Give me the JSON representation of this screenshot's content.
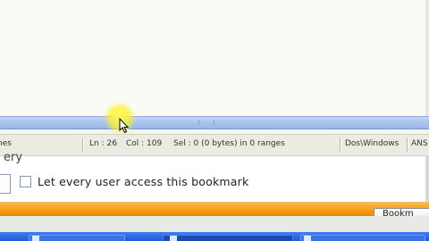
{
  "statusbar": {
    "partial_left": "nes",
    "line": "Ln : 26",
    "column": "Col : 109",
    "selection": "Sel : 0 (0 bytes) in 0 ranges",
    "line_endings": "Dos\\Windows",
    "encoding_partial": "ANS"
  },
  "form": {
    "partial_label": "ery",
    "checkbox_label": "Let every user access this bookmark",
    "checkbox_checked": false
  },
  "orange_bar": {
    "button_partial_label": "Bookm"
  },
  "colors": {
    "splitter": "#a9c3ee",
    "orange_bar": "#f59a12",
    "taskbar": "#2f67e0",
    "cursor_highlight": "#fff040"
  },
  "icons": {
    "cursor": "mouse-pointer-icon",
    "grip": "splitter-grip-icon"
  }
}
